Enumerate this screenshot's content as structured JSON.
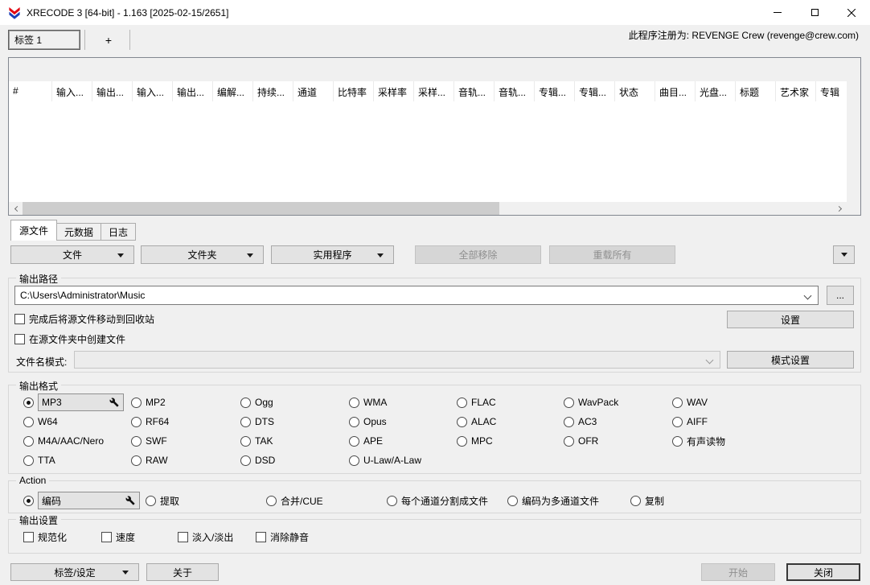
{
  "window": {
    "title": "XRECODE 3 [64-bit] - 1.163 [2025-02-15/2651]",
    "registration": "此程序注册为: REVENGE Crew (revenge@crew.com)"
  },
  "session_tabs": {
    "tab": "标签 1",
    "add": "+"
  },
  "file_table": {
    "columns": [
      "#",
      "输入...",
      "输出...",
      "输入...",
      "输出...",
      "编解...",
      "持续...",
      "通道",
      "比特率",
      "采样率",
      "采样...",
      "音轨...",
      "音轨...",
      "专辑...",
      "专辑...",
      "状态",
      "曲目...",
      "光盘...",
      "标题",
      "艺术家",
      "专辑"
    ]
  },
  "view_tabs": [
    {
      "label": "源文件",
      "active": true
    },
    {
      "label": "元数据",
      "active": false
    },
    {
      "label": "日志",
      "active": false
    }
  ],
  "toolbar": {
    "file": "文件",
    "folder": "文件夹",
    "utilities": "实用程序",
    "remove_all": "全部移除",
    "reload_all": "重载所有"
  },
  "output_path": {
    "group_label": "输出路径",
    "path_value": "C:\\Users\\Administrator\\Music",
    "browse_label": "...",
    "settings_label": "设置",
    "checkbox_recycle": "完成后将源文件移动到回收站",
    "checkbox_source_folder": "在源文件夹中创建文件",
    "pattern_label": "文件名模式:",
    "pattern_value": "",
    "pattern_settings_label": "模式设置"
  },
  "output_format": {
    "group_label": "输出格式",
    "selected": "MP3",
    "options": [
      {
        "label": "MP3",
        "selected": true,
        "boxed": true
      },
      {
        "label": "MP2"
      },
      {
        "label": "Ogg"
      },
      {
        "label": "WMA"
      },
      {
        "label": "FLAC"
      },
      {
        "label": "WavPack"
      },
      {
        "label": "WAV"
      },
      {
        "label": "W64"
      },
      {
        "label": "RF64"
      },
      {
        "label": "DTS"
      },
      {
        "label": "Opus"
      },
      {
        "label": "ALAC"
      },
      {
        "label": "AC3"
      },
      {
        "label": "AIFF"
      },
      {
        "label": "M4A/AAC/Nero"
      },
      {
        "label": "SWF"
      },
      {
        "label": "TAK"
      },
      {
        "label": "APE"
      },
      {
        "label": "MPC"
      },
      {
        "label": "OFR"
      },
      {
        "label": "有声读物"
      },
      {
        "label": "TTA"
      },
      {
        "label": "RAW"
      },
      {
        "label": "DSD"
      },
      {
        "label": "U-Law/A-Law"
      }
    ]
  },
  "action": {
    "group_label": "Action",
    "selected": "编码",
    "options": [
      {
        "label": "编码",
        "selected": true,
        "boxed": true
      },
      {
        "label": "提取"
      },
      {
        "label": "合并/CUE"
      },
      {
        "label": "每个通道分割成文件"
      },
      {
        "label": "编码为多通道文件"
      },
      {
        "label": "复制"
      }
    ]
  },
  "output_settings": {
    "group_label": "输出设置",
    "options": [
      {
        "label": "规范化"
      },
      {
        "label": "速度"
      },
      {
        "label": "淡入/淡出"
      },
      {
        "label": "消除静音"
      }
    ]
  },
  "footer": {
    "tags_settings": "标签/设定",
    "about": "关于",
    "start": "开始",
    "close": "关闭"
  }
}
